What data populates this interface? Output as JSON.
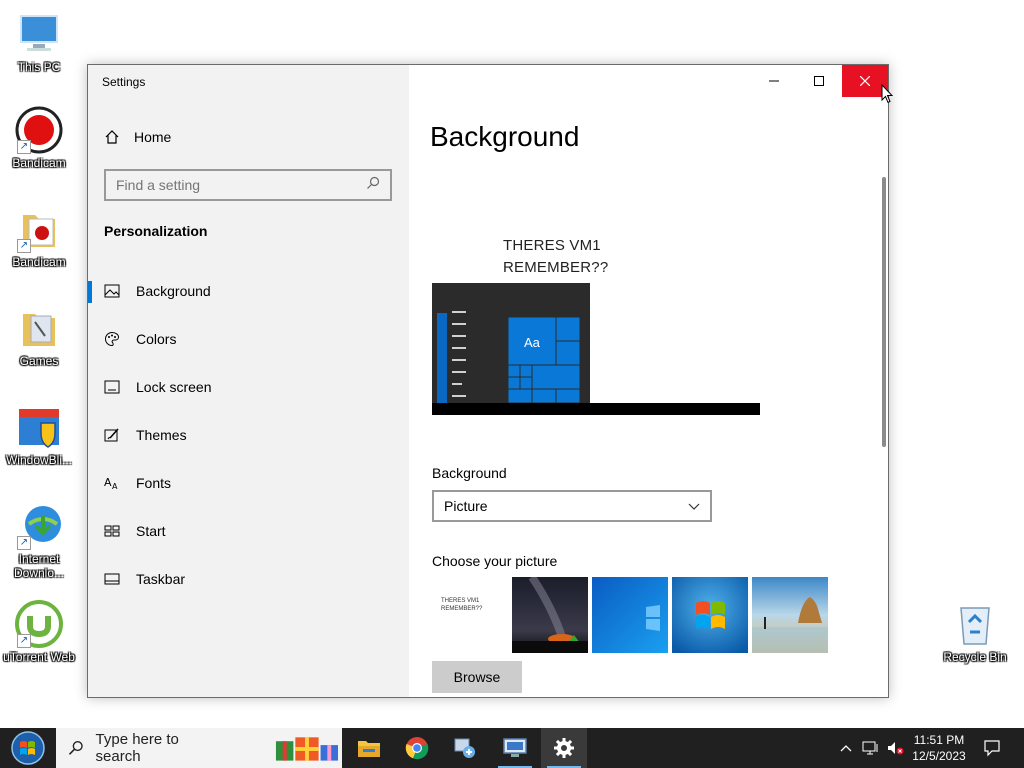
{
  "desktop": {
    "icons": [
      {
        "label": "This PC"
      },
      {
        "label": "Bandicam"
      },
      {
        "label": "Bandicam"
      },
      {
        "label": "Games"
      },
      {
        "label": "WindowBli..."
      },
      {
        "label": "Internet Downlo..."
      },
      {
        "label": "uTorrent Web"
      },
      {
        "label": "Recycle Bin"
      }
    ]
  },
  "window": {
    "title": "Settings",
    "home_label": "Home",
    "search_placeholder": "Find a setting",
    "section_title": "Personalization",
    "nav": [
      {
        "label": "Background",
        "icon": "picture-icon"
      },
      {
        "label": "Colors",
        "icon": "palette-icon"
      },
      {
        "label": "Lock screen",
        "icon": "lock-screen-icon"
      },
      {
        "label": "Themes",
        "icon": "themes-icon"
      },
      {
        "label": "Fonts",
        "icon": "fonts-icon"
      },
      {
        "label": "Start",
        "icon": "start-icon"
      },
      {
        "label": "Taskbar",
        "icon": "taskbar-icon"
      }
    ],
    "active_nav": "Background",
    "page_title": "Background",
    "preview_text_line1": "THERES VM1",
    "preview_text_line2": "REMEMBER??",
    "preview_tile_label": "Aa",
    "background_label": "Background",
    "background_value": "Picture",
    "choose_label": "Choose your picture",
    "thumb1_line1": "THERES VM1",
    "thumb1_line2": "REMEMBER??",
    "browse_label": "Browse",
    "accent_color": "#0078d7",
    "close_color": "#e81123"
  },
  "taskbar": {
    "search_placeholder": "Type here to search",
    "time": "11:51 PM",
    "date": "12/5/2023"
  }
}
